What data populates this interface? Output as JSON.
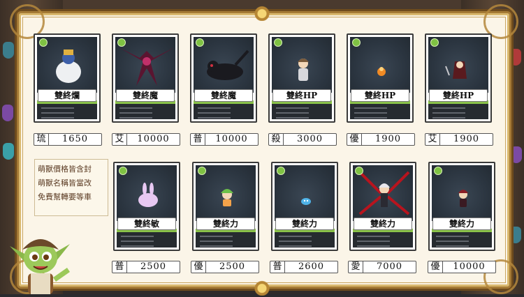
{
  "cards": [
    {
      "name": "雙終爛",
      "price_tag": "琉",
      "price": "1650",
      "art": "white-beast-rider"
    },
    {
      "name": "雙終魔",
      "price_tag": "艾",
      "price": "10000",
      "art": "dark-winged-demon"
    },
    {
      "name": "雙終魔",
      "price_tag": "普",
      "price": "10000",
      "art": "shadow-panther"
    },
    {
      "name": "雙終HP",
      "price_tag": "殺",
      "price": "3000",
      "art": "small-girl"
    },
    {
      "name": "雙終HP",
      "price_tag": "優",
      "price": "1900",
      "art": "tiny-orange-pet"
    },
    {
      "name": "雙終HP",
      "price_tag": "艾",
      "price": "1900",
      "art": "red-hooded-reaper"
    },
    {
      "name": "雙終敏",
      "price_tag": "普",
      "price": "2500",
      "art": "pink-bunny"
    },
    {
      "name": "雙終力",
      "price_tag": "優",
      "price": "2500",
      "art": "green-haired-child"
    },
    {
      "name": "雙終力",
      "price_tag": "普",
      "price": "2600",
      "art": "blue-slime"
    },
    {
      "name": "雙終力",
      "price_tag": "愛",
      "price": "7000",
      "art": "red-spider-lady"
    },
    {
      "name": "雙終力",
      "price_tag": "優",
      "price": "10000",
      "art": "dark-mini-warrior"
    }
  ],
  "note": {
    "lines": [
      "萌獸價格皆含封",
      "萌獸名稱皆當改",
      "免費幫轉要等車"
    ]
  },
  "colors": {
    "frame_gold": "#a57a36",
    "paper": "#fbf5e8",
    "badge_green": "#7fc243",
    "stat_bar_green": "#8bc34a"
  }
}
